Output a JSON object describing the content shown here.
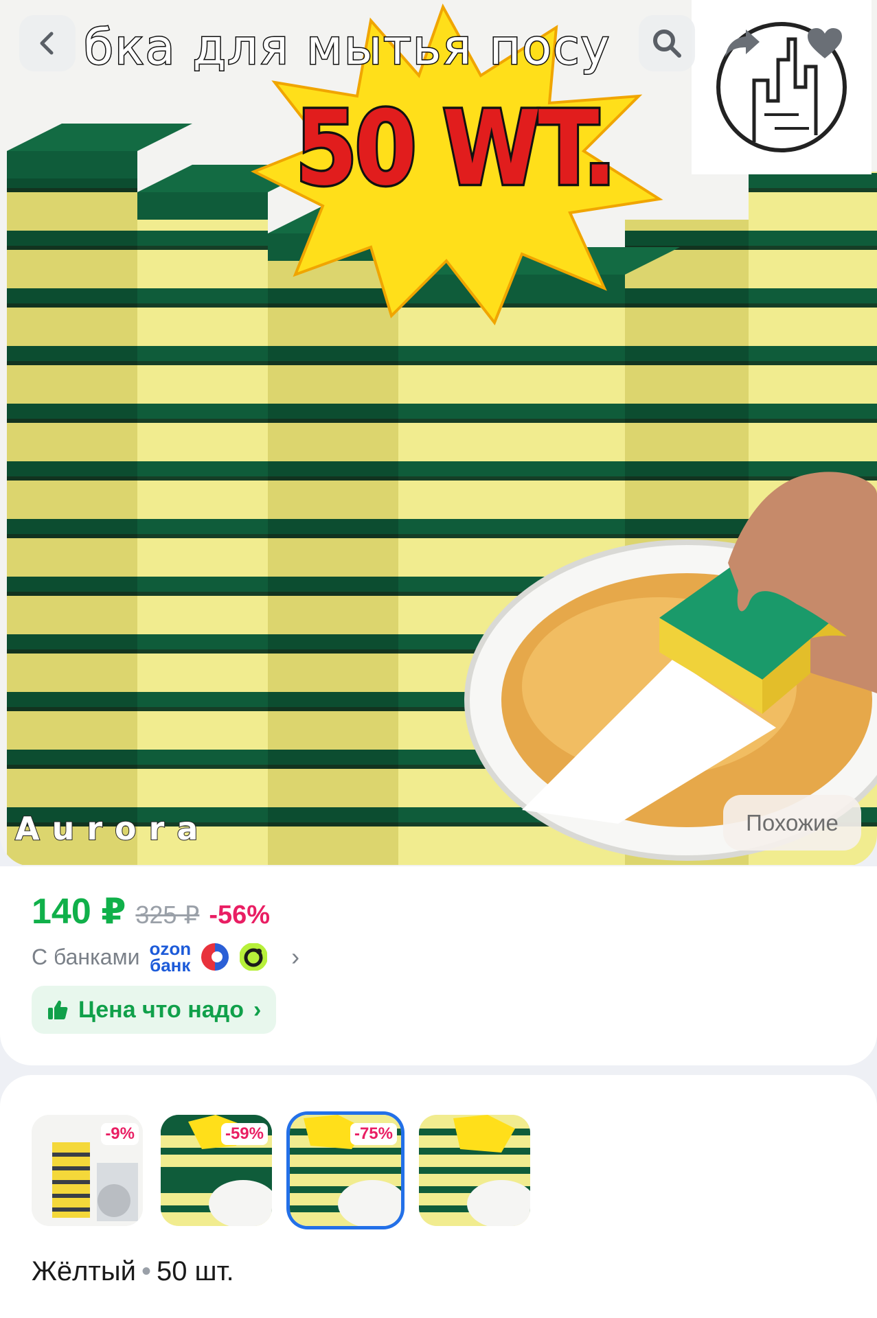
{
  "hero": {
    "title_overlay": "бка для мытья посу",
    "badge": "50 WT.",
    "brand": "Aurora",
    "similar_button": "Похожие"
  },
  "toolbar": {
    "back_icon": "chevron-left",
    "search_icon": "search",
    "share_icon": "share-arrow",
    "favorite_icon": "heart"
  },
  "price": {
    "current": "140 ₽",
    "old": "325 ₽",
    "discount": "-56%",
    "banks_label": "С банками",
    "ozon_bank_line1": "ozon",
    "ozon_bank_line2": "банк",
    "deal_label": "Цена что надо"
  },
  "variants": {
    "items": [
      {
        "discount": "-9%",
        "selected": false
      },
      {
        "discount": "-59%",
        "selected": false
      },
      {
        "discount": "-75%",
        "selected": true
      },
      {
        "discount": "",
        "selected": false
      }
    ],
    "caption_color": "Жёлтый",
    "caption_separator": "•",
    "caption_qty": "50 шт."
  },
  "colors": {
    "price_green": "#10b04a",
    "discount_pink": "#e91e63",
    "selected_border": "#2370e8",
    "sponge_yellow": "#f2ee9a",
    "sponge_green": "#0f5c3a"
  }
}
